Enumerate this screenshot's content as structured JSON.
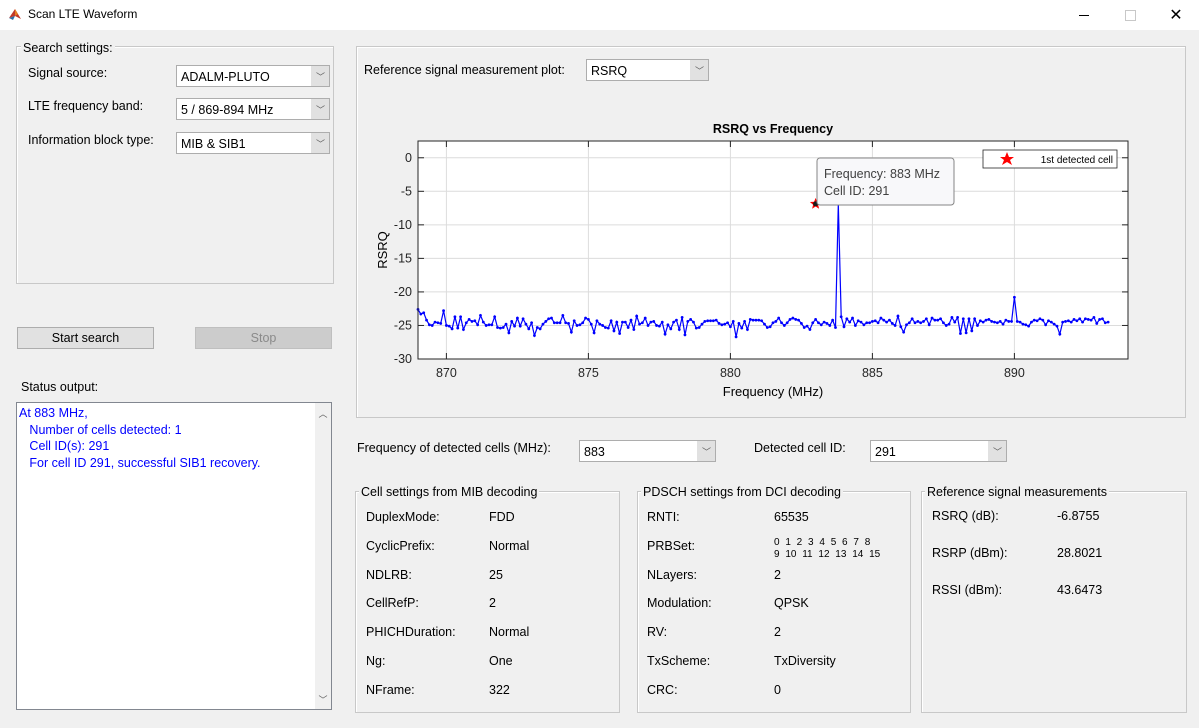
{
  "window": {
    "title": "Scan LTE Waveform",
    "controls": [
      "minimize",
      "maximize",
      "close"
    ]
  },
  "search_settings": {
    "title": "Search settings:",
    "signal_source": {
      "label": "Signal source:",
      "value": "ADALM-PLUTO"
    },
    "frequency_band": {
      "label": "LTE frequency band:",
      "value": "5 / 869-894 MHz"
    },
    "info_block": {
      "label": "Information block type:",
      "value": "MIB & SIB1"
    }
  },
  "buttons": {
    "start": "Start search",
    "stop": "Stop"
  },
  "status": {
    "label": "Status output:",
    "text": "At 883 MHz,\n   Number of cells detected: 1\n   Cell ID(s): 291\n   For cell ID 291, successful SIB1 recovery."
  },
  "plot_panel": {
    "selector_label": "Reference signal measurement plot:",
    "selector_value": "RSRQ",
    "datatip": {
      "line1": "Frequency: 883 MHz",
      "line2": "Cell ID: 291"
    }
  },
  "detected": {
    "freq_label": "Frequency of detected cells (MHz):",
    "freq_value": "883",
    "cellid_label": "Detected cell ID:",
    "cellid_value": "291"
  },
  "mib": {
    "title": "Cell settings from MIB decoding",
    "rows": [
      {
        "key": "DuplexMode:",
        "value": "FDD"
      },
      {
        "key": "CyclicPrefix:",
        "value": "Normal"
      },
      {
        "key": "NDLRB:",
        "value": "25"
      },
      {
        "key": "CellRefP:",
        "value": "2"
      },
      {
        "key": "PHICHDuration:",
        "value": "Normal"
      },
      {
        "key": "Ng:",
        "value": "One"
      },
      {
        "key": "NFrame:",
        "value": "322"
      }
    ]
  },
  "pdsch": {
    "title": "PDSCH settings from DCI decoding",
    "rows": [
      {
        "key": "RNTI:",
        "value": "65535"
      },
      {
        "key": "PRBSet:",
        "value": "0 1 2 3 4 5 6 7 8\n9 10 11 12 13 14 15"
      },
      {
        "key": "NLayers:",
        "value": "2"
      },
      {
        "key": "Modulation:",
        "value": "QPSK"
      },
      {
        "key": "RV:",
        "value": "2"
      },
      {
        "key": "TxScheme:",
        "value": "TxDiversity"
      },
      {
        "key": "CRC:",
        "value": "0"
      }
    ]
  },
  "refsig": {
    "title": "Reference signal measurements",
    "rows": [
      {
        "key": "RSRQ (dB):",
        "value": "-6.8755"
      },
      {
        "key": "RSRP (dBm):",
        "value": "28.8021"
      },
      {
        "key": "RSSI (dBm):",
        "value": "43.6473"
      }
    ]
  },
  "colors": {
    "line": "#0000ff",
    "marker": "#ff0000",
    "background": "#f0f0f0",
    "status_text": "#0000ff"
  },
  "chart_data": {
    "type": "line",
    "title": "RSRQ vs Frequency",
    "xlabel": "Frequency (MHz)",
    "ylabel": "RSRQ",
    "xlim": [
      869,
      894
    ],
    "ylim": [
      -30,
      2.5
    ],
    "xticks": [
      870,
      875,
      880,
      885,
      890
    ],
    "yticks": [
      0,
      -5,
      -10,
      -15,
      -20,
      -25,
      -30
    ],
    "grid": true,
    "legend": {
      "entries": [
        "1st detected cell"
      ],
      "placement": "top-right"
    },
    "detected_cell": {
      "x": 883,
      "y": -6.8755,
      "label": "1st detected cell"
    },
    "series": [
      {
        "name": "RSRQ",
        "x_start": 869,
        "x_step": 0.1,
        "values": [
          -22.6,
          -23.3,
          -23.1,
          -24.2,
          -24.9,
          -25.0,
          -24.5,
          -24.6,
          -24.7,
          -22.8,
          -25.0,
          -25.1,
          -25.5,
          -23.7,
          -25.4,
          -23.7,
          -25.6,
          -24.6,
          -24.1,
          -24.4,
          -24.3,
          -24.9,
          -23.5,
          -24.5,
          -25.0,
          -24.9,
          -24.9,
          -23.7,
          -25.3,
          -25.4,
          -25.3,
          -24.8,
          -26.1,
          -24.4,
          -25.1,
          -23.9,
          -25.1,
          -24.0,
          -24.8,
          -25.5,
          -24.6,
          -26.5,
          -25.3,
          -25.5,
          -24.8,
          -24.4,
          -24.0,
          -23.9,
          -24.6,
          -24.6,
          -24.6,
          -23.5,
          -24.6,
          -24.7,
          -26.0,
          -24.3,
          -25.0,
          -24.9,
          -24.6,
          -23.9,
          -24.1,
          -24.8,
          -26.1,
          -24.3,
          -24.8,
          -25.0,
          -25.3,
          -25.4,
          -24.3,
          -25.8,
          -24.5,
          -26.2,
          -24.5,
          -24.5,
          -25.3,
          -24.2,
          -25.6,
          -23.6,
          -24.8,
          -24.6,
          -23.9,
          -25.0,
          -24.5,
          -24.4,
          -25.0,
          -25.1,
          -24.5,
          -26.3,
          -24.9,
          -25.5,
          -24.5,
          -24.2,
          -25.6,
          -23.8,
          -26.4,
          -24.4,
          -24.1,
          -24.5,
          -25.4,
          -25.3,
          -24.8,
          -24.4,
          -24.3,
          -24.3,
          -24.3,
          -24.2,
          -24.7,
          -24.9,
          -24.8,
          -24.6,
          -25.2,
          -24.4,
          -26.7,
          -24.7,
          -25.4,
          -24.4,
          -25.6,
          -24.1,
          -24.2,
          -24.2,
          -24.2,
          -24.3,
          -24.8,
          -25.3,
          -25.2,
          -24.6,
          -24.4,
          -23.9,
          -24.6,
          -25.0,
          -24.6,
          -24.1,
          -23.9,
          -24.1,
          -24.2,
          -24.7,
          -25.3,
          -25.1,
          -25.6,
          -24.6,
          -24.1,
          -24.6,
          -24.9,
          -24.5,
          -24.7,
          -25.0,
          -24.2,
          -25.3,
          -6.8755,
          -23.7,
          -25.2,
          -24.0,
          -24.5,
          -23.9,
          -25.0,
          -24.3,
          -24.5,
          -24.9,
          -24.6,
          -24.6,
          -24.4,
          -24.3,
          -24.6,
          -23.9,
          -24.2,
          -24.5,
          -24.2,
          -24.7,
          -25.0,
          -23.6,
          -25.2,
          -26.0,
          -24.9,
          -24.6,
          -24.0,
          -24.6,
          -24.4,
          -24.6,
          -24.4,
          -24.0,
          -24.9,
          -23.9,
          -24.2,
          -24.2,
          -24.0,
          -24.6,
          -25.0,
          -24.8,
          -23.8,
          -24.5,
          -23.8,
          -26.2,
          -24.0,
          -26.1,
          -24.0,
          -25.8,
          -24.0,
          -25.0,
          -24.3,
          -24.5,
          -24.2,
          -24.1,
          -24.4,
          -24.5,
          -24.6,
          -24.4,
          -24.8,
          -24.2,
          -24.4,
          -24.4,
          -20.8,
          -24.4,
          -24.5,
          -24.8,
          -24.9,
          -25.1,
          -24.5,
          -24.2,
          -24.3,
          -24.0,
          -24.2,
          -24.9,
          -24.3,
          -24.5,
          -24.8,
          -25.1,
          -26.3,
          -24.5,
          -24.4,
          -24.3,
          -24.5,
          -24.1,
          -24.3,
          -24.0,
          -24.5,
          -24.0,
          -24.1,
          -24.2,
          -23.8,
          -24.7,
          -24.1,
          -24.0,
          -24.6,
          -24.5
        ]
      }
    ]
  }
}
